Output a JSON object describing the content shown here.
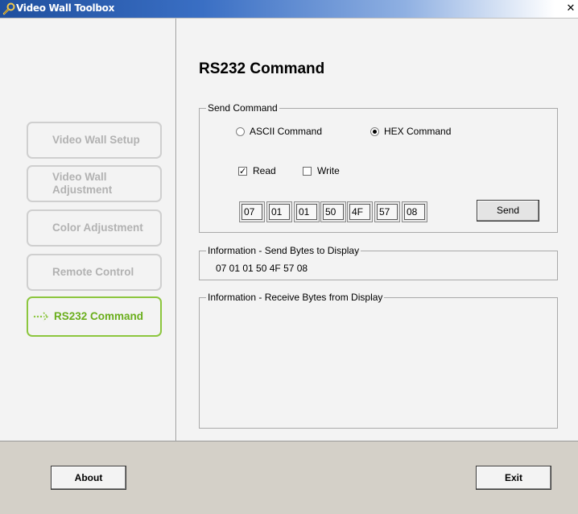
{
  "window": {
    "title": "Video Wall Toolbox",
    "close_glyph": "✕",
    "icon": "wrench-icon",
    "title_bar_color": "#1f4f9e"
  },
  "nav": {
    "items": [
      {
        "label": "Video Wall Setup",
        "active": false
      },
      {
        "label": "Video Wall Adjustment",
        "active": false
      },
      {
        "label": "Color Adjustment",
        "active": false
      },
      {
        "label": "Remote Control",
        "active": false
      },
      {
        "label": "RS232 Command",
        "active": true,
        "icon": "dotted-arrow-icon"
      }
    ],
    "active_color": "#6aae1c",
    "inactive_color": "#b2b2b2"
  },
  "main": {
    "title": "RS232 Command",
    "send_command": {
      "legend": "Send Command",
      "mode_options": [
        {
          "label": "ASCII Command",
          "selected": false
        },
        {
          "label": "HEX Command",
          "selected": true
        }
      ],
      "read": {
        "label": "Read",
        "checked": true
      },
      "write": {
        "label": "Write",
        "checked": false
      },
      "bytes": [
        "07",
        "01",
        "01",
        "50",
        "4F",
        "57",
        "08"
      ],
      "send_label": "Send"
    },
    "send_info": {
      "legend": "Information - Send Bytes to Display",
      "value": "07 01 01 50 4F 57 08"
    },
    "receive_info": {
      "legend": "Information - Receive Bytes from Display",
      "value": ""
    }
  },
  "footer": {
    "about_label": "About",
    "exit_label": "Exit"
  }
}
